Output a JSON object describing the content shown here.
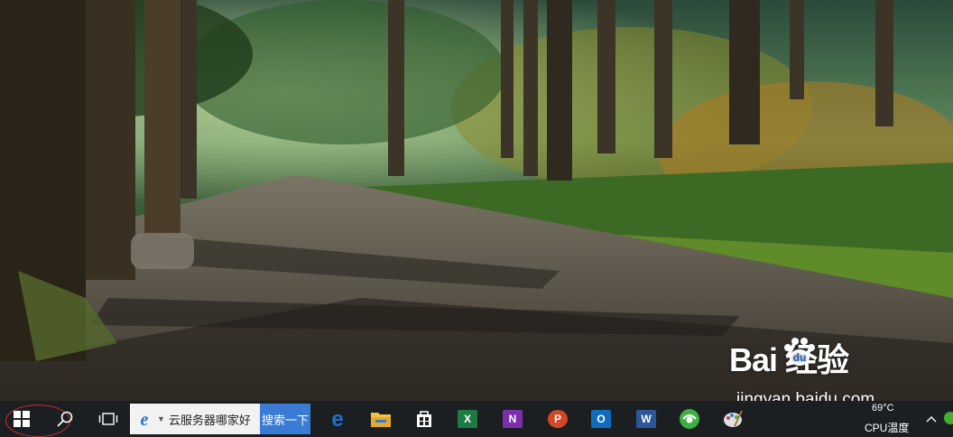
{
  "taskbar": {
    "search": {
      "query": "云服务器哪家好",
      "button_label": "搜索一下"
    },
    "apps": [
      {
        "name": "edge",
        "letter": "e",
        "color": "#1f6fd2"
      },
      {
        "name": "file-explorer",
        "letter": "",
        "color": "#f2c14a"
      },
      {
        "name": "store",
        "letter": "",
        "color": "#ffffff"
      },
      {
        "name": "excel",
        "letter": "X",
        "color": "#1e7a45"
      },
      {
        "name": "onenote",
        "letter": "N",
        "color": "#7b2fae"
      },
      {
        "name": "powerpoint",
        "letter": "P",
        "color": "#d24726"
      },
      {
        "name": "outlook",
        "letter": "O",
        "color": "#0f6cbd"
      },
      {
        "name": "word",
        "letter": "W",
        "color": "#2b579a"
      },
      {
        "name": "360-browser",
        "letter": "",
        "color": "#3cb043"
      },
      {
        "name": "paint",
        "letter": "",
        "color": "#e0e0e0"
      }
    ],
    "tray": {
      "temperature": "69°C",
      "temperature_label": "CPU温度"
    }
  },
  "watermark": {
    "logo": "Bai  经验",
    "url": "jingyan.baidu.com"
  }
}
